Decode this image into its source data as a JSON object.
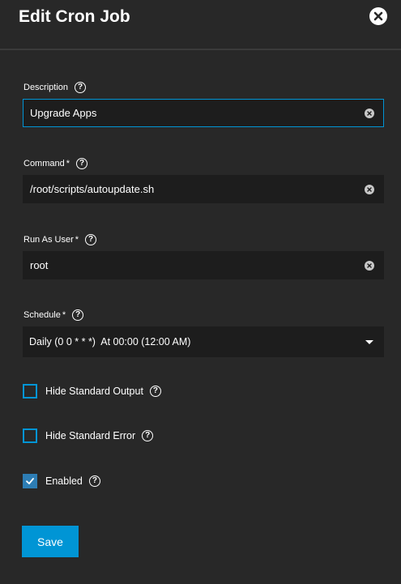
{
  "dialog": {
    "title": "Edit Cron Job"
  },
  "fields": {
    "description": {
      "label": "Description",
      "value": "Upgrade Apps",
      "required": false
    },
    "command": {
      "label": "Command",
      "required_marker": "*",
      "value": "/root/scripts/autoupdate.sh"
    },
    "run_as_user": {
      "label": "Run As User",
      "required_marker": "*",
      "value": "root"
    },
    "schedule": {
      "label": "Schedule",
      "required_marker": "*",
      "value": "Daily (0 0 * * *)  At 00:00 (12:00 AM)"
    }
  },
  "checkboxes": {
    "hide_stdout": {
      "label": "Hide Standard Output",
      "checked": false
    },
    "hide_stderr": {
      "label": "Hide Standard Error",
      "checked": false
    },
    "enabled": {
      "label": "Enabled",
      "checked": true
    }
  },
  "help_glyph": "?",
  "actions": {
    "save_label": "Save"
  },
  "colors": {
    "background": "#282828",
    "field_background": "#1d1d1d",
    "accent": "#0095d5",
    "checked": "#2d7db4"
  },
  "icons": {
    "close": "close-circle-icon",
    "clear": "clear-circle-icon",
    "help": "help-circle-icon",
    "dropdown": "caret-down-icon",
    "check": "check-icon"
  }
}
